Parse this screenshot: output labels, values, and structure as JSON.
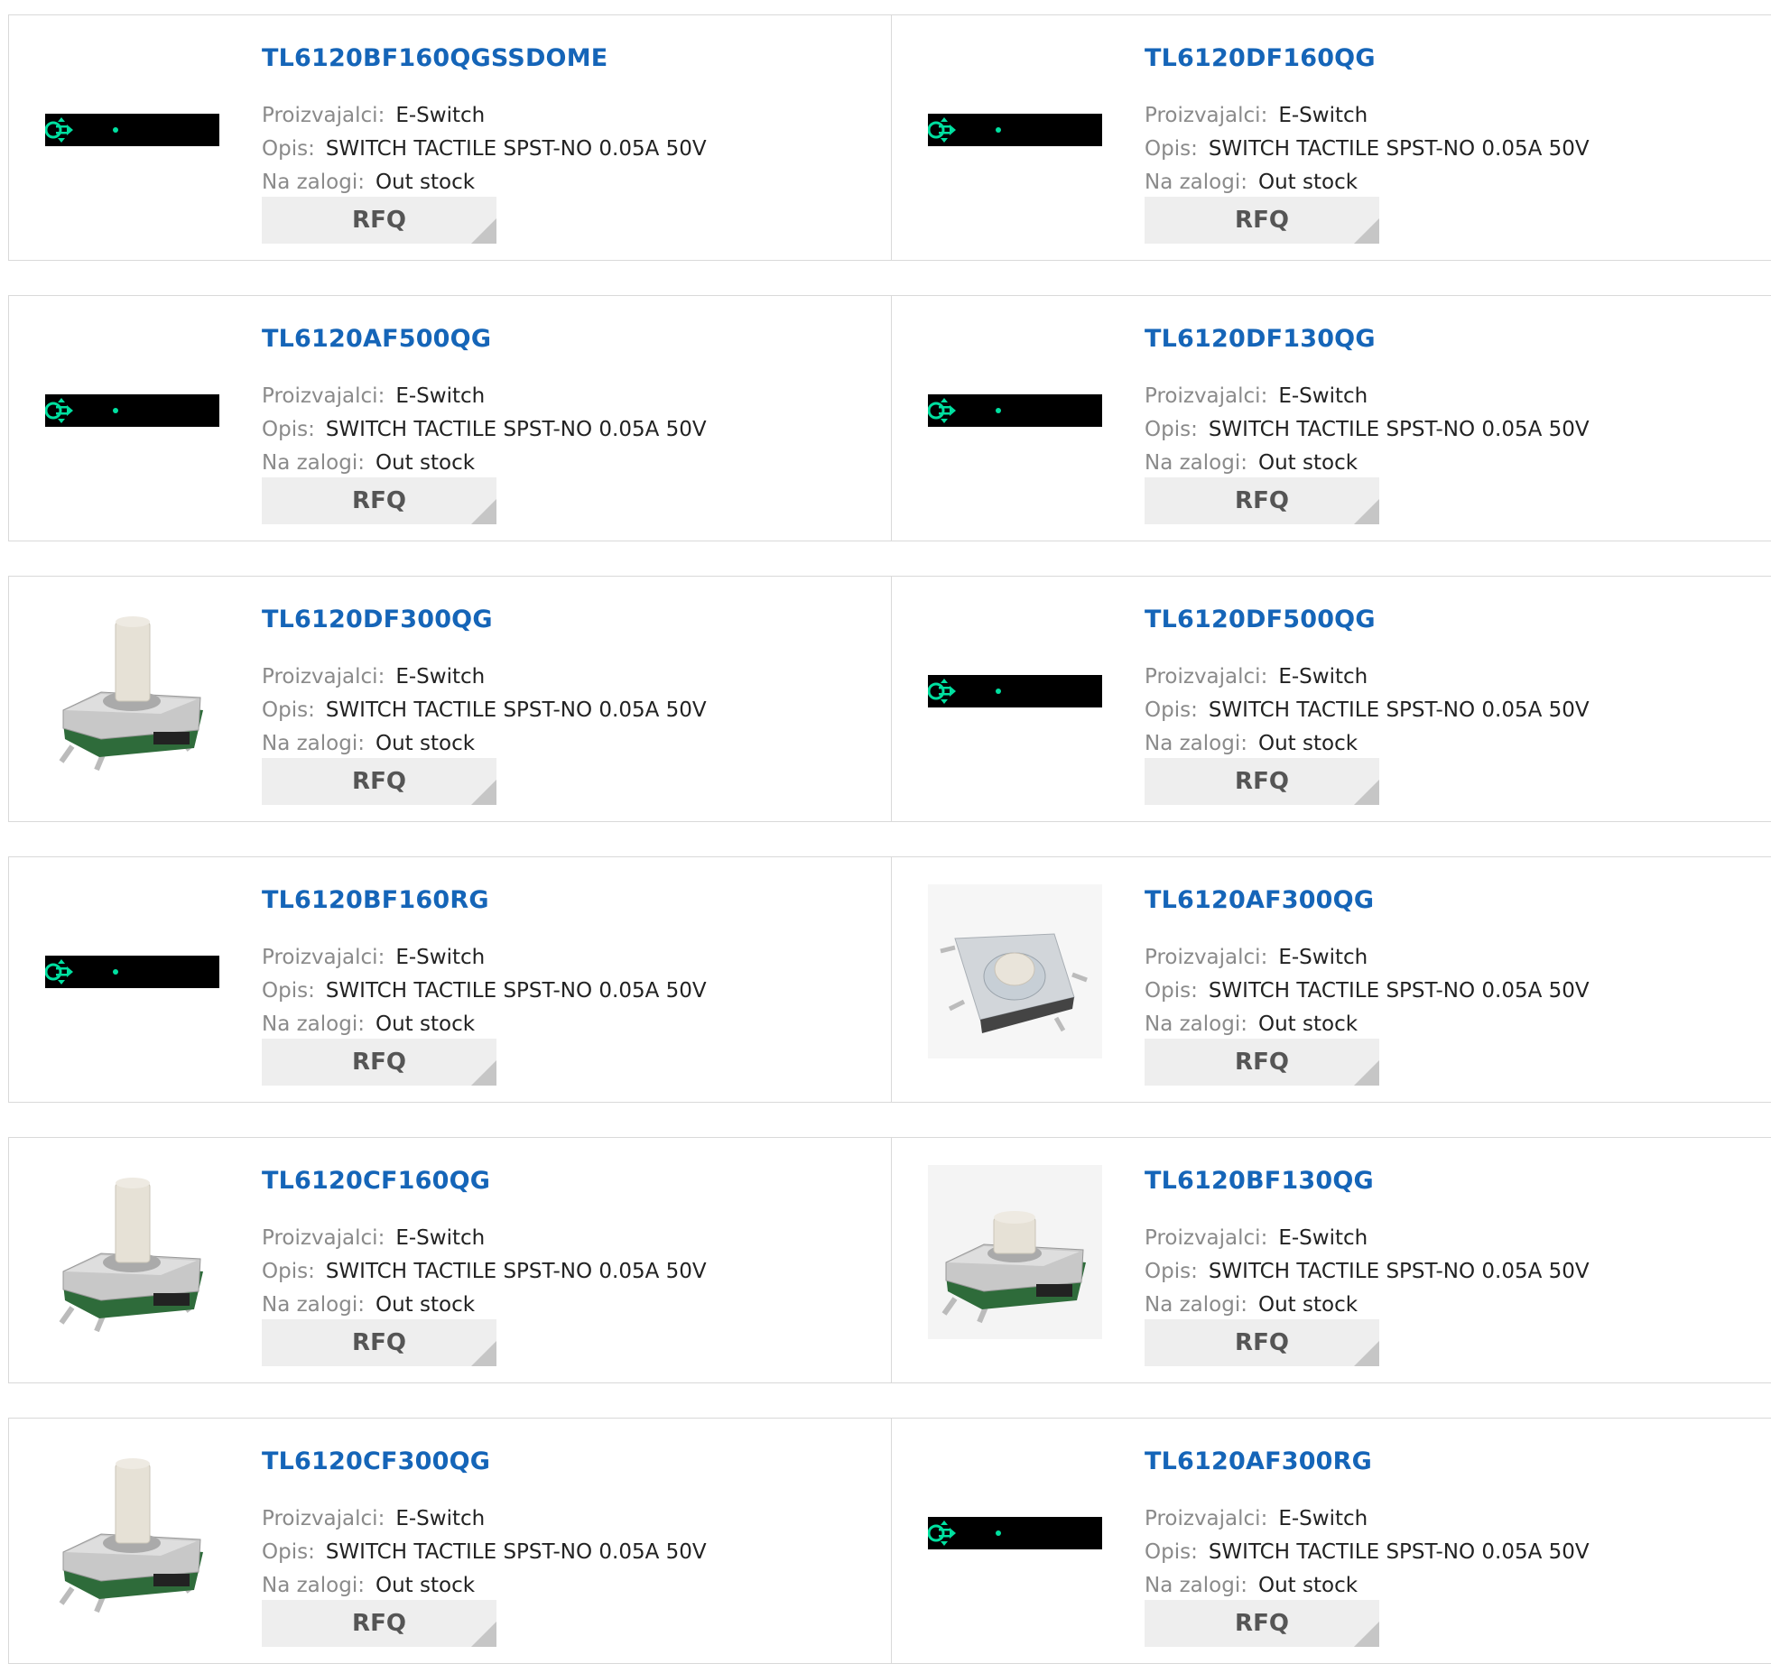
{
  "labels": {
    "manufacturer": "Proizvajalci:",
    "description": "Opis:",
    "stock": "Na zalogi:",
    "rfq": "RFQ"
  },
  "icons": {
    "placeholder": "broken-image-placeholder-icon",
    "tall": "tactile-switch-tall-actuator-icon",
    "short": "tactile-switch-short-actuator-icon",
    "flat": "tactile-switch-flat-round-actuator-icon"
  },
  "colors": {
    "title": "#1565b8",
    "button_bg": "#eeeeee",
    "accent_green": "#00e0a0"
  },
  "products": [
    {
      "part": "TL6120BF160QGSSDOME",
      "manufacturer": "E-Switch",
      "description": "SWITCH TACTILE SPST-NO 0.05A 50V",
      "stock": "Out stock",
      "image": "placeholder"
    },
    {
      "part": "TL6120DF160QG",
      "manufacturer": "E-Switch",
      "description": "SWITCH TACTILE SPST-NO 0.05A 50V",
      "stock": "Out stock",
      "image": "placeholder"
    },
    {
      "part": "TL6120AF500QG",
      "manufacturer": "E-Switch",
      "description": "SWITCH TACTILE SPST-NO 0.05A 50V",
      "stock": "Out stock",
      "image": "placeholder"
    },
    {
      "part": "TL6120DF130QG",
      "manufacturer": "E-Switch",
      "description": "SWITCH TACTILE SPST-NO 0.05A 50V",
      "stock": "Out stock",
      "image": "placeholder"
    },
    {
      "part": "TL6120DF300QG",
      "manufacturer": "E-Switch",
      "description": "SWITCH TACTILE SPST-NO 0.05A 50V",
      "stock": "Out stock",
      "image": "tall"
    },
    {
      "part": "TL6120DF500QG",
      "manufacturer": "E-Switch",
      "description": "SWITCH TACTILE SPST-NO 0.05A 50V",
      "stock": "Out stock",
      "image": "placeholder"
    },
    {
      "part": "TL6120BF160RG",
      "manufacturer": "E-Switch",
      "description": "SWITCH TACTILE SPST-NO 0.05A 50V",
      "stock": "Out stock",
      "image": "placeholder"
    },
    {
      "part": "TL6120AF300QG",
      "manufacturer": "E-Switch",
      "description": "SWITCH TACTILE SPST-NO 0.05A 50V",
      "stock": "Out stock",
      "image": "flat"
    },
    {
      "part": "TL6120CF160QG",
      "manufacturer": "E-Switch",
      "description": "SWITCH TACTILE SPST-NO 0.05A 50V",
      "stock": "Out stock",
      "image": "tall"
    },
    {
      "part": "TL6120BF130QG",
      "manufacturer": "E-Switch",
      "description": "SWITCH TACTILE SPST-NO 0.05A 50V",
      "stock": "Out stock",
      "image": "short"
    },
    {
      "part": "TL6120CF300QG",
      "manufacturer": "E-Switch",
      "description": "SWITCH TACTILE SPST-NO 0.05A 50V",
      "stock": "Out stock",
      "image": "tall"
    },
    {
      "part": "TL6120AF300RG",
      "manufacturer": "E-Switch",
      "description": "SWITCH TACTILE SPST-NO 0.05A 50V",
      "stock": "Out stock",
      "image": "placeholder"
    }
  ]
}
